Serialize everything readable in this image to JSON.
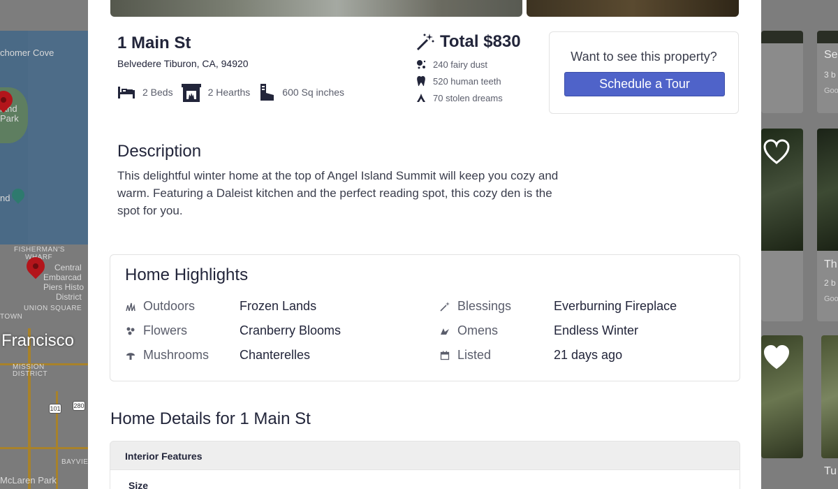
{
  "map": {
    "labels": {
      "cove": "chomer Cove",
      "island_park_1": "land",
      "island_park_2": "Park",
      "nd": "nd",
      "fishermans": "FISHERMAN'S",
      "wharf": "WHARF",
      "central": "Central",
      "embarcadero": "Embarcad",
      "piers_historic": "Piers Histo",
      "district": "District",
      "union_square": "UNION SQUARE",
      "town": "TOWN",
      "francisco": "Francisco",
      "mission": "MISSION",
      "mission_district": "DISTRICT",
      "bayview": "BAYVIE",
      "mclaren": "McLaren Park"
    },
    "shields": [
      "101",
      "280"
    ]
  },
  "listings": {
    "cards": [
      {
        "title": "Se",
        "beds": "3 b",
        "sub": "Goo"
      },
      {
        "title": "Th",
        "beds": "2 b",
        "sub": "Goo"
      },
      {
        "title": "Tu"
      }
    ]
  },
  "property": {
    "address": "1 Main St",
    "city_line": "Belvedere Tiburon, CA, 94920",
    "facts": {
      "beds": "2 Beds",
      "hearths": "2 Hearths",
      "size": "600 Sq inches"
    },
    "total": "Total $830",
    "costs": [
      {
        "icon": "fairy-dust-icon",
        "label": "240 fairy dust"
      },
      {
        "icon": "tooth-icon",
        "label": "520 human teeth"
      },
      {
        "icon": "dream-icon",
        "label": "70 stolen dreams"
      }
    ]
  },
  "tour": {
    "question": "Want to see this property?",
    "button": "Schedule a Tour"
  },
  "description": {
    "heading": "Description",
    "text": "This delightful winter home at the top of Angel Island Summit will keep you cozy and warm. Featuring a Daleist kitchen and the perfect reading spot, this cozy den is the spot for you."
  },
  "highlights": {
    "heading": "Home Highlights",
    "items": [
      {
        "icon": "grass-icon",
        "key": "Outdoors",
        "value": "Frozen Lands"
      },
      {
        "icon": "flower-icon",
        "key": "Flowers",
        "value": "Cranberry Blooms"
      },
      {
        "icon": "mushroom-icon",
        "key": "Mushrooms",
        "value": "Chanterelles"
      },
      {
        "icon": "magic-wand-icon",
        "key": "Blessings",
        "value": "Everburning Fireplace"
      },
      {
        "icon": "omen-icon",
        "key": "Omens",
        "value": "Endless Winter"
      },
      {
        "icon": "calendar-icon",
        "key": "Listed",
        "value": "21 days ago"
      }
    ]
  },
  "details": {
    "heading": "Home Details for 1 Main St",
    "section": "Interior Features",
    "subsection": "Size"
  },
  "colors": {
    "accent": "#4f63c9",
    "text": "#22253a",
    "muted": "#5a5d6b",
    "pin": "#b3151b"
  }
}
